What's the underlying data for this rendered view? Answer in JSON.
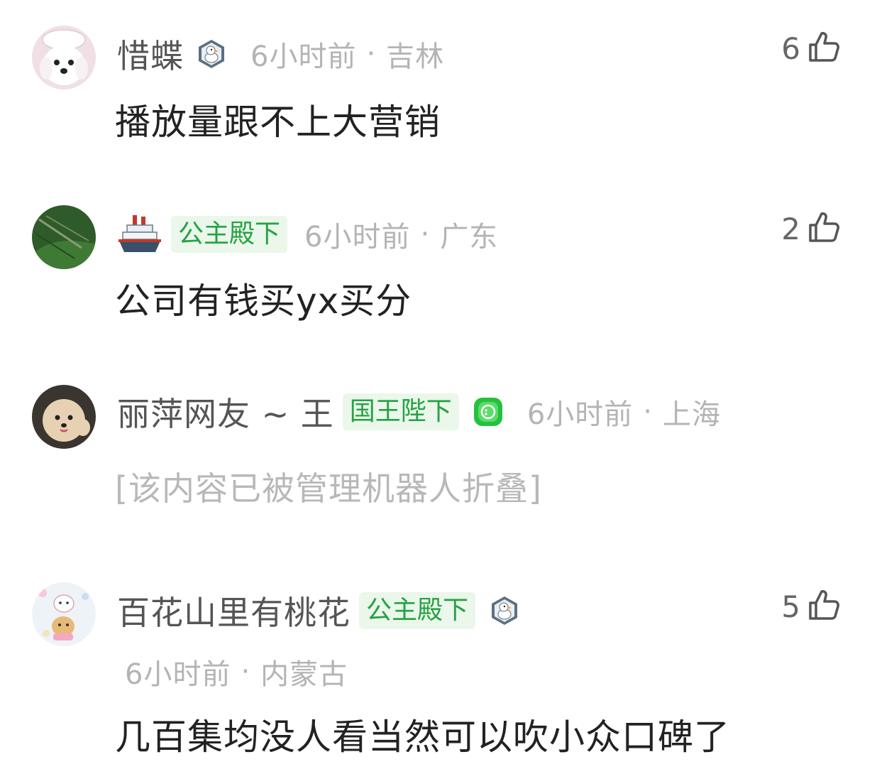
{
  "comments": [
    {
      "username": "惜蝶",
      "time": "6小时前",
      "separator": "·",
      "location": "吉林",
      "text": "播放量跟不上大营销",
      "likes": "6",
      "avatar_icon": "white-puppy-avatar",
      "level_icon": "duck-level-icon"
    },
    {
      "username": "",
      "badge": "公主殿下",
      "time": "6小时前",
      "separator": "·",
      "location": "广东",
      "text": "公司有钱买yx买分",
      "likes": "2",
      "avatar_icon": "grass-photo-avatar",
      "name_icon": "ship-emoji-icon"
    },
    {
      "username": "丽萍网友 ~ 王",
      "badge": "国王陛下",
      "time": "6小时前",
      "separator": "·",
      "location": "上海",
      "text": "[该内容已被管理机器人折叠]",
      "avatar_icon": "dog-photo-avatar",
      "status_icon": "green-face-icon"
    },
    {
      "username": "百花山里有桃花",
      "badge": "公主殿下",
      "time": "6小时前",
      "separator": "·",
      "location": "内蒙古",
      "text": "几百集均没人看当然可以吹小众口碑了",
      "likes": "5",
      "avatar_icon": "cartoon-bear-avatar",
      "level_icon": "duck-level-icon"
    }
  ],
  "colors": {
    "badge_bg": "#eaf7ea",
    "badge_text": "#25a244",
    "meta_text": "#b4b4b4",
    "username_text": "#555555",
    "body_text": "#222222"
  }
}
